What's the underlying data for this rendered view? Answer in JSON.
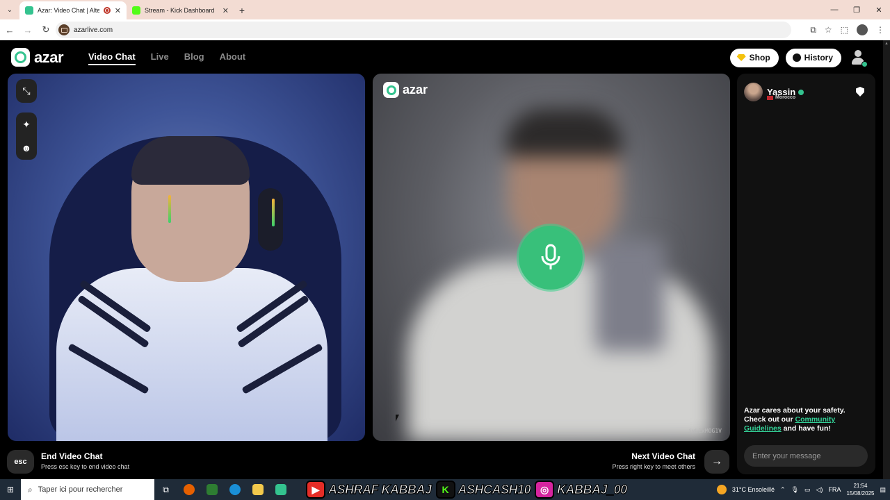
{
  "browser": {
    "tabs": [
      {
        "title": "Azar: Video Chat | Alternati",
        "active": true,
        "favicon_color": "#34c38f"
      },
      {
        "title": "Stream - Kick Dashboard",
        "active": false,
        "favicon_color": "#53fc18"
      }
    ],
    "new_tab": "+",
    "url": "azarlive.com"
  },
  "app": {
    "brand": "azar",
    "nav": [
      {
        "label": "Video Chat",
        "active": true
      },
      {
        "label": "Live",
        "active": false
      },
      {
        "label": "Blog",
        "active": false
      },
      {
        "label": "About",
        "active": false
      }
    ],
    "shop_label": "Shop",
    "history_label": "History"
  },
  "remote_video": {
    "brand": "azar",
    "watermark": "ivLZxMOG1V"
  },
  "chat": {
    "peer_name": "Yassin",
    "peer_country": "Morocco",
    "safety_line1": "Azar cares about your safety.",
    "safety_line2_pre": "Check out our ",
    "safety_link": "Community Guidelines",
    "safety_line2_post": " and have fun!",
    "message_placeholder": "Enter your message"
  },
  "controls": {
    "esc_key": "esc",
    "end_title": "End Video Chat",
    "end_sub": "Press esc key to end video chat",
    "next_title": "Next Video Chat",
    "next_sub": "Press right key to meet others",
    "next_arrow": "→"
  },
  "taskbar": {
    "search_placeholder": "Taper ici pour rechercher",
    "social": [
      {
        "platform": "youtube-icon",
        "handle": "ASHRAF KABBAJ",
        "color": "#e52d27"
      },
      {
        "platform": "kick-icon",
        "handle": "ASHCASH10",
        "color": "#53fc18"
      },
      {
        "platform": "instagram-icon",
        "handle": "KABBAJ_00",
        "color": "#d6249f"
      }
    ],
    "weather": "31°C  Ensoleillé",
    "language": "FRA",
    "time": "21:54",
    "date": "15/08/2025"
  }
}
